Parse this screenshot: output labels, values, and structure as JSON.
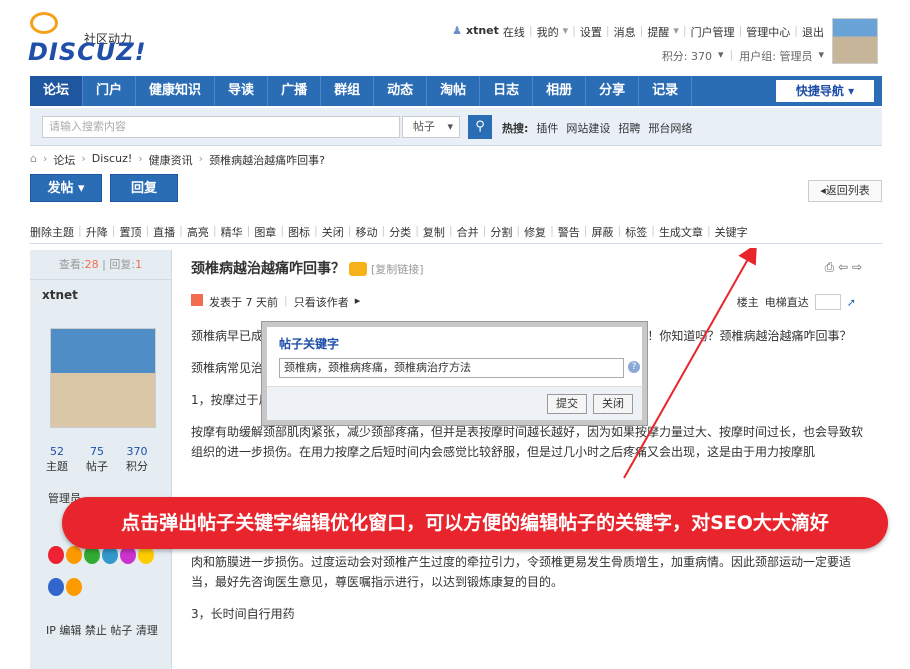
{
  "header": {
    "logo_small": "社区动力",
    "logo_big": "DISCUZ!",
    "user_menu": [
      "xtnet",
      "在线",
      "我的",
      "设置",
      "消息",
      "提醒",
      "门户管理",
      "管理中心",
      "退出"
    ],
    "credits": "积分: 370",
    "usergroup": "用户组: 管理员"
  },
  "nav": {
    "items": [
      "论坛",
      "门户",
      "健康知识",
      "导读",
      "广播",
      "群组",
      "动态",
      "淘帖",
      "日志",
      "相册",
      "分享",
      "记录"
    ],
    "quick": "快捷导航"
  },
  "search": {
    "placeholder": "请输入搜索内容",
    "type": "帖子",
    "hot_label": "热搜:",
    "hot": [
      "插件",
      "网站建设",
      "招聘",
      "邢台网络"
    ]
  },
  "breadcrumb": [
    "论坛",
    "Discuz!",
    "健康资讯",
    "颈椎病越治越痛咋回事?"
  ],
  "buttons": {
    "post": "发帖",
    "reply": "回复",
    "back": "返回列表"
  },
  "modbar": [
    "删除主题",
    "升降",
    "置顶",
    "直播",
    "高亮",
    "精华",
    "图章",
    "图标",
    "关闭",
    "移动",
    "分类",
    "复制",
    "合并",
    "分割",
    "修复",
    "警告",
    "屏蔽",
    "标签",
    "生成文章",
    "关键字"
  ],
  "left": {
    "views_label": "查看:",
    "views": "28",
    "replies_label": "回复:",
    "replies": "1",
    "username": "xtnet",
    "stats": [
      {
        "v": "52",
        "l": "主题"
      },
      {
        "v": "75",
        "l": "帖子"
      },
      {
        "v": "370",
        "l": "积分"
      }
    ],
    "admin_label": "管理员",
    "ops": "IP 编辑 禁止 帖子 清理"
  },
  "post": {
    "title": "颈椎病越治越痛咋回事？",
    "copy_link": "[复制链接]",
    "posted": "发表于 7 天前",
    "only_author": "只看该作者",
    "floor_owner": "楼主",
    "floor_jump": "电梯直达",
    "paras": [
      "颈椎病早已成为许多人的“职业病”，经常伏案工作，脖子僵硬、酸痛，动一动就嘎嘎响！你知道吗？颈椎病越治越痛咋回事？",
      "颈椎病常见治疗误区：",
      "1，按摩过于用力",
      "按摩有助缓解颈部肌肉紧张，减少颈部疼痛，但并是表按摩时间越长越好，因为如果按摩力量过大、按摩时间过长，也会导致软组织的进一步损伤。在用力按摩之后短时间内会感觉比较舒服，但是过几小时之后疼痛又会出现，这是由于用力按摩肌",
      "有些颈椎病病情通过颈部运动会得到一定缓解，但是部分患者治病心切，增加了大量超过适当生理范围的运动，结果就会导致肌肉和筋膜进一步损伤。过度运动会对颈椎产生过度的牵拉引力，令颈椎更易发生骨质增生，加重病情。因此颈部运动一定要适当，最好先咨询医生意见，尊医嘱指示进行，以达到锻炼康复的目的。",
      "3，长时间自行用药"
    ]
  },
  "dialog": {
    "title": "帖子关键字",
    "value": "颈椎病，颈椎病疼痛，颈椎病治疗方法",
    "submit": "提交",
    "close": "关闭"
  },
  "banner": "点击弹出帖子关键字编辑优化窗口，可以方便的编辑帖子的关键字，对SEO大大滴好",
  "colors": {
    "brand": "#2b6db5",
    "banner": "#e8242c",
    "arrow": "#e8242c"
  }
}
